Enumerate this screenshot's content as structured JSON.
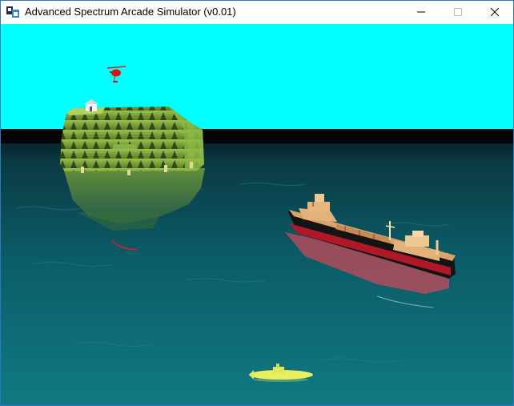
{
  "window": {
    "title": "Advanced Spectrum Arcade Simulator (v0.01)",
    "icon": "app-icon",
    "controls": [
      "minimize-icon",
      "maximize-icon",
      "close-icon"
    ]
  },
  "scene": {
    "sky_color": "#00ffff",
    "horizon_color": "#000000",
    "sea_color": "#0b5f6a",
    "objects": [
      "helicopter",
      "island",
      "cargo-ship",
      "submarine"
    ],
    "colors": {
      "helicopter": "#e01010",
      "island_grass": "#7fa83a",
      "ship_hull": "#1a1a1a",
      "ship_waterline": "#b01828",
      "ship_deck": "#d9a36a",
      "submarine": "#e8f060"
    }
  }
}
